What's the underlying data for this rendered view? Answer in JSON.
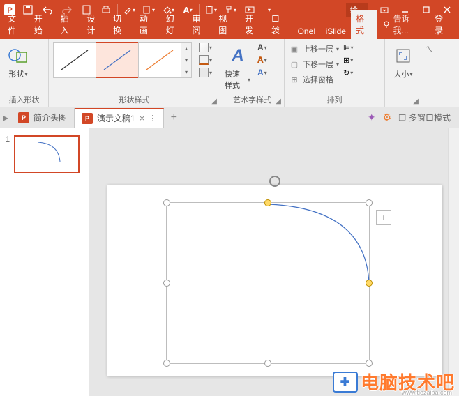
{
  "titlebar": {
    "app_initial": "P",
    "title_hint": "绘...",
    "qat": [
      "save",
      "undo",
      "redo",
      "new",
      "print",
      "eyedropper",
      "copy-format",
      "paint-bucket",
      "font-format",
      "paste",
      "format-painter",
      "launch"
    ]
  },
  "tabs": {
    "items": [
      {
        "label": "文件"
      },
      {
        "label": "开始"
      },
      {
        "label": "插入"
      },
      {
        "label": "设计"
      },
      {
        "label": "切换"
      },
      {
        "label": "动画"
      },
      {
        "label": "幻灯"
      },
      {
        "label": "审阅"
      },
      {
        "label": "视图"
      },
      {
        "label": "开发"
      },
      {
        "label": "口袋"
      },
      {
        "label": "OneI"
      },
      {
        "label": "iSlide"
      },
      {
        "label": "格式"
      }
    ],
    "active_index": 13,
    "tell_me": "告诉我...",
    "login": "登录"
  },
  "ribbon": {
    "insert_shapes": {
      "label": "插入形状",
      "btn": "形状"
    },
    "shape_styles": {
      "label": "形状样式"
    },
    "wordart_styles": {
      "label": "艺术字样式",
      "btn": "快速样式"
    },
    "arrange": {
      "label": "排列",
      "bring_forward": "上移一层",
      "send_backward": "下移一层",
      "selection_pane": "选择窗格"
    },
    "size": {
      "label": "大小"
    }
  },
  "doctabs": {
    "items": [
      {
        "label": "简介头图"
      },
      {
        "label": "演示文稿1"
      }
    ],
    "active_index": 1,
    "multi_window": "多窗口模式"
  },
  "thumbs": {
    "items": [
      {
        "num": "1"
      }
    ]
  },
  "watermark": {
    "text": "电脑技术吧",
    "sub": "www.tiezaiba.com"
  }
}
